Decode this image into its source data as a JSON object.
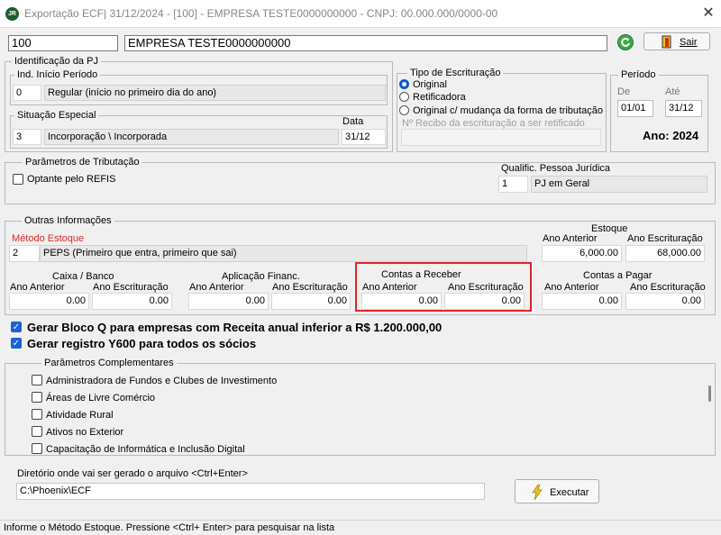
{
  "window": {
    "app_icon": "JR",
    "title": "Exportação ECF|  31/12/2024 - [100] - EMPRESA TESTE0000000000 - CNPJ: 00.000.000/0000-00",
    "close_glyph": "✕"
  },
  "header": {
    "company_code": "100",
    "company_name": "EMPRESA TESTE0000000000",
    "exit_label": "Sair"
  },
  "identificacao": {
    "legend": "Identificação da PJ",
    "inicio": {
      "legend": "Ind. Início Período",
      "code": "0",
      "desc": "Regular (início no primeiro dia do ano)"
    },
    "situacao": {
      "legend": "Situação Especial",
      "code": "3",
      "desc": "Incorporação \\ Incorporada",
      "date_label": "Data",
      "date": "31/12"
    }
  },
  "escrituracao": {
    "legend": "Tipo de Escrituração",
    "options": [
      "Original",
      "Retificadora",
      "Original c/ mudança da forma de tributação"
    ],
    "selected": 0,
    "recibo_placeholder": "Nº Recibo da escrituração a ser retificado"
  },
  "periodo": {
    "legend": "Período",
    "de_label": "De",
    "de": "01/01",
    "ate_label": "Até",
    "ate": "31/12",
    "ano": "Ano: 2024"
  },
  "tributacao": {
    "legend": "Parâmetros de Tributação",
    "refis_label": "Optante pelo REFIS",
    "qualif_label": "Qualific. Pessoa Jurídica",
    "qualif_code": "1",
    "qualif_desc": "PJ em Geral"
  },
  "outras": {
    "legend": "Outras Informações",
    "metodo_label": "Método Estoque",
    "metodo_code": "2",
    "metodo_desc": "PEPS (Primeiro que entra, primeiro que sai)",
    "estoque": {
      "title": "Estoque",
      "ant_label": "Ano Anterior",
      "esc_label": "Ano Escrituração",
      "ant": "6,000.00",
      "esc": "68,000.00"
    },
    "caixa": {
      "title": "Caixa / Banco",
      "ant_label": "Ano  Anterior",
      "esc_label": "Ano Escrituração",
      "ant": "0.00",
      "esc": "0.00"
    },
    "aplicacao": {
      "title": "Aplicação Financ.",
      "ant_label": "Ano  Anterior",
      "esc_label": "Ano Escrituração",
      "ant": "0.00",
      "esc": "0.00"
    },
    "receber": {
      "title": "Contas a Receber",
      "ant_label": "Ano Anterior",
      "esc_label": "Ano Escrituração",
      "ant": "0.00",
      "esc": "0.00"
    },
    "pagar": {
      "title": "Contas a Pagar",
      "ant_label": "Ano Anterior",
      "esc_label": "Ano Escrituração",
      "ant": "0.00",
      "esc": "0.00"
    }
  },
  "options": {
    "bloco_q": "Gerar Bloco Q para empresas com Receita anual inferior a R$ 1.200.000,00",
    "y600": "Gerar registro Y600 para todos os sócios"
  },
  "complementares": {
    "legend": "Parâmetros Complementares",
    "items": [
      "Administradora de Fundos e Clubes de Investimento",
      "Áreas de Livre Comércio",
      "Atividade Rural",
      "Ativos no Exterior",
      "Capacitação de Informática e Inclusão Digital"
    ]
  },
  "diretorio": {
    "label": "Diretório onde vai ser gerado o arquivo <Ctrl+Enter>",
    "path": "C:\\Phoenix\\ECF",
    "run_label": "Executar"
  },
  "status": "Informe o Método Estoque. Pressione <Ctrl+ Enter> para pesquisar na lista",
  "colors": {
    "highlight": "#e0262b",
    "method_label": "#e0262b",
    "checked": "#1a63d6"
  }
}
